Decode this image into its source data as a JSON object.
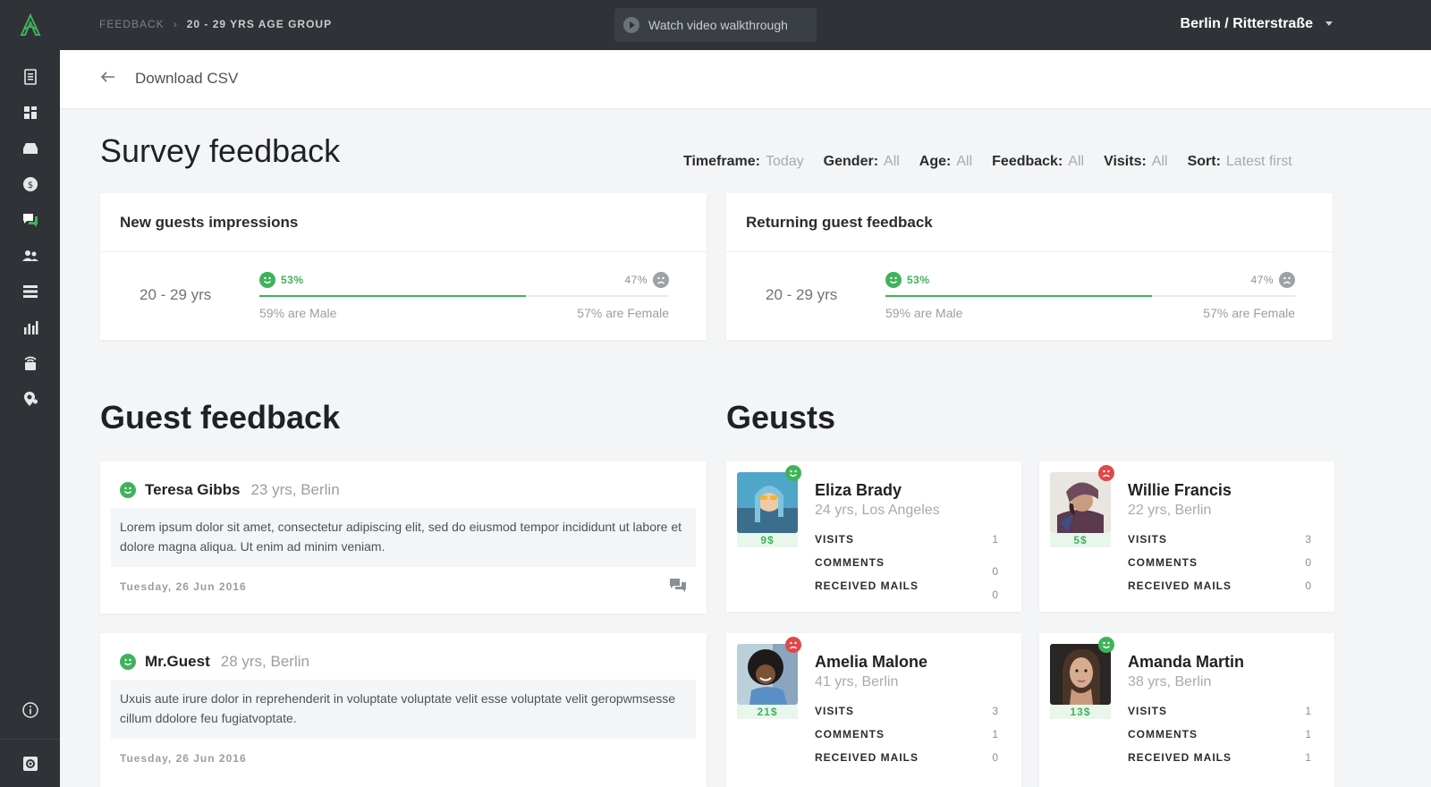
{
  "topbar": {
    "breadcrumb": [
      "FEEDBACK",
      "20 - 29 YRS AGE GROUP"
    ],
    "video_label": "Watch video walkthrough",
    "location": "Berlin / Ritterstraße"
  },
  "toolbar": {
    "download_label": "Download CSV"
  },
  "sidebar": {
    "items": [
      "reports-icon",
      "dashboard-icon",
      "inbox-icon",
      "revenue-icon",
      "feedback-icon",
      "guests-icon",
      "list-icon",
      "stats-icon",
      "wifi-icon",
      "location-icon"
    ],
    "active_index": 4
  },
  "survey": {
    "title": "Survey feedback",
    "filters": [
      {
        "label": "Timeframe:",
        "value": "Today"
      },
      {
        "label": "Gender:",
        "value": "All"
      },
      {
        "label": "Age:",
        "value": "All"
      },
      {
        "label": "Feedback:",
        "value": "All"
      },
      {
        "label": "Visits:",
        "value": "All"
      },
      {
        "label": "Sort:",
        "value": "Latest first"
      }
    ]
  },
  "impressions": [
    {
      "title": "New guests impressions",
      "age": "20 - 29 yrs",
      "positive_pct": "53%",
      "negative_pct": "47%",
      "positive_fraction": 0.65,
      "male": "59% are Male",
      "female": "57% are Female"
    },
    {
      "title": "Returning guest feedback",
      "age": "20 - 29 yrs",
      "positive_pct": "53%",
      "negative_pct": "47%",
      "positive_fraction": 0.65,
      "male": "59% are Male",
      "female": "57% are Female"
    }
  ],
  "guest_feedback": {
    "title": "Guest feedback",
    "items": [
      {
        "name": "Teresa Gibbs",
        "meta": "23 yrs, Berlin",
        "text": "Lorem ipsum dolor sit amet, consectetur adipiscing elit, sed do eiusmod tempor incididunt ut labore et dolore magna aliqua. Ut enim ad minim veniam.",
        "date": "Tuesday, 26 Jun 2016"
      },
      {
        "name": "Mr.Guest",
        "meta": "28 yrs, Berlin",
        "text": "Uxuis aute irure dolor in reprehenderit in voluptate voluptate velit esse voluptate velit geropwmsesse cillum ddolore feu fugiatvoptate.",
        "date": "Tuesday, 26 Jun 2016"
      }
    ]
  },
  "guests": {
    "title": "Geusts",
    "stat_labels": [
      "VISITS",
      "COMMENTS",
      "RECEIVED MAILS"
    ],
    "items": [
      {
        "name": "Eliza Brady",
        "meta": "24 yrs, Los Angeles",
        "price": "9$",
        "mood": "happy",
        "visits": "1",
        "comments": "0",
        "mails": "0"
      },
      {
        "name": "Willie Francis",
        "meta": "22 yrs, Berlin",
        "price": "5$",
        "mood": "sad",
        "visits": "3",
        "comments": "0",
        "mails": "0"
      },
      {
        "name": "Amelia Malone",
        "meta": "41 yrs, Berlin",
        "price": "21$",
        "mood": "sad",
        "visits": "3",
        "comments": "1",
        "mails": "0"
      },
      {
        "name": "Amanda Martin",
        "meta": "38 yrs, Berlin",
        "price": "13$",
        "mood": "happy",
        "visits": "1",
        "comments": "1",
        "mails": "1"
      }
    ]
  },
  "colors": {
    "accent": "#3fb35a",
    "negative": "#e04848",
    "sidebar": "#2f3337"
  }
}
